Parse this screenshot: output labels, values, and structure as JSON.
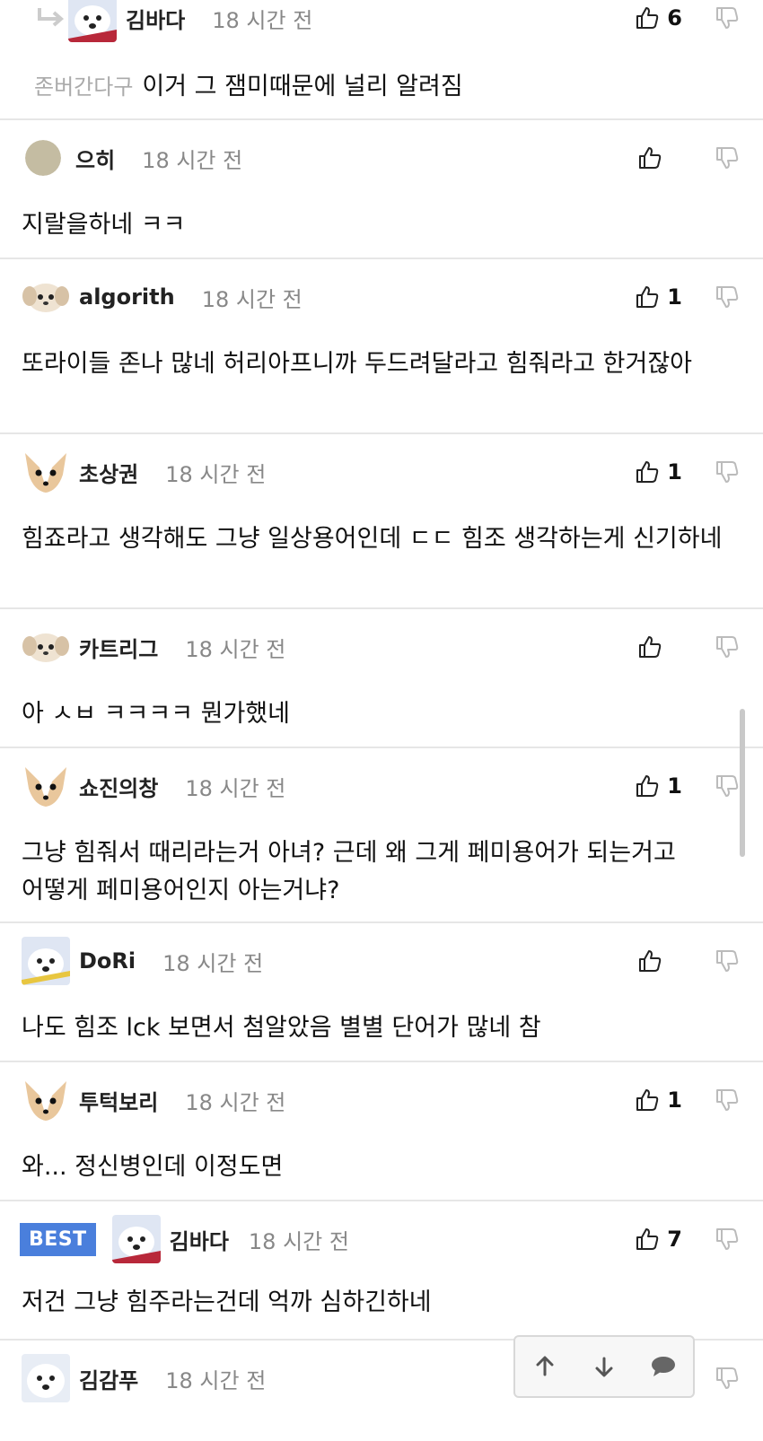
{
  "comments": [
    {
      "author": "김바다",
      "time": "18 시간 전",
      "likes": "6",
      "reply_to": "존버간다구",
      "text": "이거 그 잼미때문에 널리 알려짐",
      "avatar": "polar-bear"
    },
    {
      "author": "으히",
      "time": "18 시간 전",
      "likes": "",
      "text": "지랄을하네 ㅋㅋ",
      "avatar": "beige-circle"
    },
    {
      "author": "algorith",
      "time": "18 시간 전",
      "likes": "1",
      "text": "또라이들 존나 많네 허리아프니까 두드려달라고 힘줘라고 한거잖아",
      "avatar": "puppy"
    },
    {
      "author": "초상권",
      "time": "18 시간 전",
      "likes": "1",
      "text": "힘죠라고 생각해도 그냥 일상용어인데 ㄷㄷ 힘조 생각하는게 신기하네",
      "avatar": "chihuahua"
    },
    {
      "author": "카트리그",
      "time": "18 시간 전",
      "likes": "",
      "text": "아 ㅅㅂ ㅋㅋㅋㅋ 뭔가했네",
      "avatar": "puppy"
    },
    {
      "author": "쇼진의창",
      "time": "18 시간 전",
      "likes": "1",
      "text": "그냥 힘줘서 때리라는거 아녀? 근데 왜 그게 페미용어가 되는거고 어떻게 페미용어인지 아는거냐?",
      "avatar": "chihuahua"
    },
    {
      "author": "DoRi",
      "time": "18 시간 전",
      "likes": "",
      "text": "나도 힘조 lck 보면서 첨알았음 별별 단어가 많네 참",
      "avatar": "polar-bear"
    },
    {
      "author": "투턱보리",
      "time": "18 시간 전",
      "likes": "1",
      "text": "와... 정신병인데 이정도면",
      "avatar": "chihuahua"
    },
    {
      "author": "김바다",
      "time": "18 시간 전",
      "likes": "7",
      "badge": "BEST",
      "text": "저건 그냥 힘주라는건데 억까 심하긴하네",
      "avatar": "polar-bear"
    },
    {
      "author": "김감푸",
      "time": "18 시간 전",
      "likes": "",
      "text": "",
      "avatar": "white-dog"
    }
  ],
  "icons": {
    "like": "thumbs-up-icon",
    "dislike": "thumbs-down-icon",
    "reply": "reply-arrow-icon",
    "up": "arrow-up-icon",
    "down": "arrow-down-icon",
    "comment": "speech-bubble-icon"
  },
  "colors": {
    "best": "#4a7fdc",
    "meta": "#888888",
    "divider": "#e6e6e6"
  }
}
